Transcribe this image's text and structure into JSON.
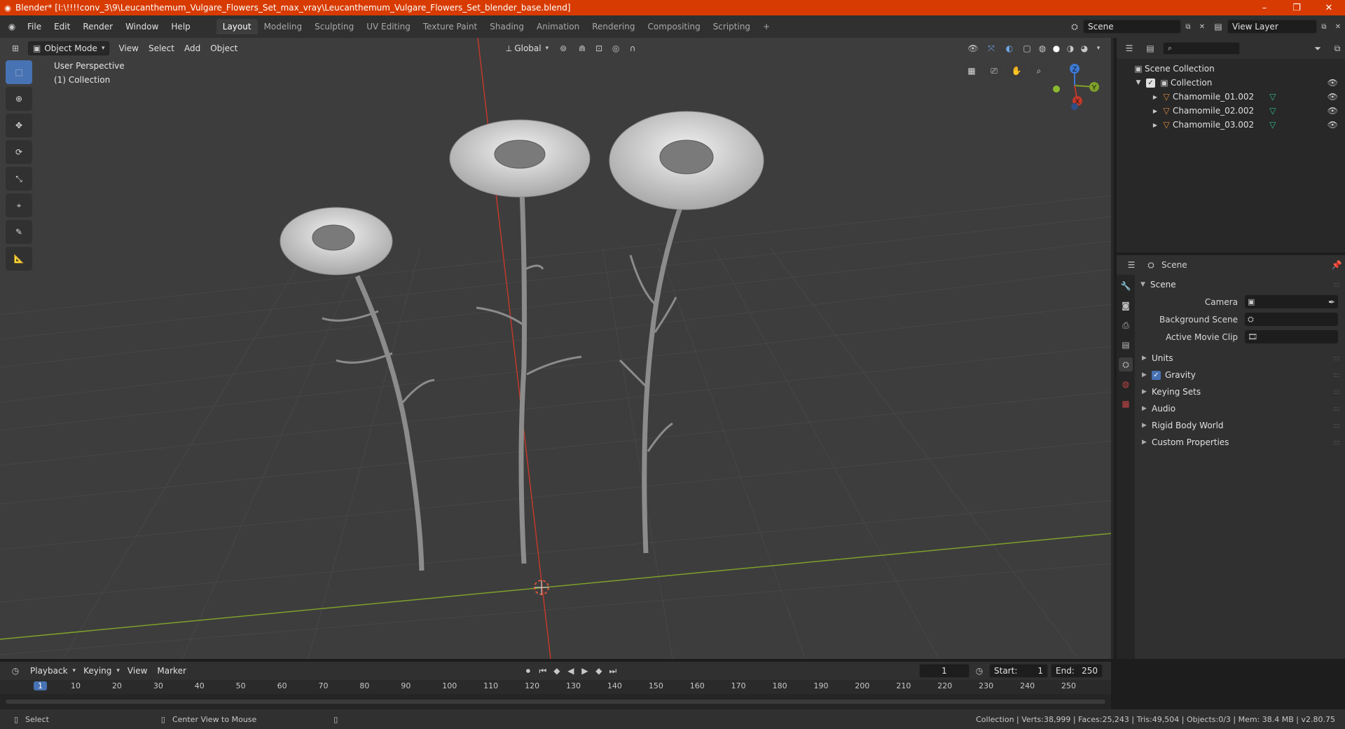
{
  "window": {
    "title": "Blender* [I:\\!!!!conv_3\\9\\Leucanthemum_Vulgare_Flowers_Set_max_vray\\Leucanthemum_Vulgare_Flowers_Set_blender_base.blend]",
    "minimize": "–",
    "maximize": "❐",
    "close": "✕"
  },
  "menu": [
    "File",
    "Edit",
    "Render",
    "Window",
    "Help"
  ],
  "workspaces": [
    "Layout",
    "Modeling",
    "Sculpting",
    "UV Editing",
    "Texture Paint",
    "Shading",
    "Animation",
    "Rendering",
    "Compositing",
    "Scripting"
  ],
  "active_workspace": "Layout",
  "add_workspace": "+",
  "scene_field": "Scene",
  "viewlayer_field": "View Layer",
  "viewport": {
    "mode": "Object Mode",
    "menus": [
      "View",
      "Select",
      "Add",
      "Object"
    ],
    "orientation": "Global",
    "info_line1": "User Perspective",
    "info_line2": "(1) Collection"
  },
  "gizmo": {
    "z": "Z",
    "y": "Y",
    "x": "X"
  },
  "outliner": {
    "search_placeholder": "",
    "root": "Scene Collection",
    "collection": "Collection",
    "objects": [
      "Chamomile_01.002",
      "Chamomile_02.002",
      "Chamomile_03.002"
    ]
  },
  "properties": {
    "context": "Scene",
    "panel": "Scene",
    "fields": [
      {
        "label": "Camera",
        "value": ""
      },
      {
        "label": "Background Scene",
        "value": ""
      },
      {
        "label": "Active Movie Clip",
        "value": ""
      }
    ],
    "sections": [
      "Units",
      "Gravity",
      "Keying Sets",
      "Audio",
      "Rigid Body World",
      "Custom Properties"
    ],
    "gravity_checked": true
  },
  "timeline": {
    "menus": [
      "Playback",
      "Keying",
      "View",
      "Marker"
    ],
    "current_frame": "1",
    "start_label": "Start:",
    "start": "1",
    "end_label": "End:",
    "end": "250",
    "ticks": [
      "1",
      "10",
      "20",
      "30",
      "40",
      "50",
      "60",
      "70",
      "80",
      "90",
      "100",
      "110",
      "120",
      "130",
      "140",
      "150",
      "160",
      "170",
      "180",
      "190",
      "200",
      "210",
      "220",
      "230",
      "240",
      "250"
    ]
  },
  "status": {
    "left": "Select",
    "middle": "Center View to Mouse",
    "right": "Collection | Verts:38,999 | Faces:25,243 | Tris:49,504 | Objects:0/3 | Mem: 38.4 MB | v2.80.75"
  },
  "colors": {
    "titlebar": "#d83b01",
    "accent": "#4772b3",
    "x_axis": "#c0392b",
    "y_axis": "#7fa02a",
    "z_axis": "#3b79d6",
    "object_icon": "#e08b3a",
    "mesh_icon": "#2fbf8a"
  }
}
